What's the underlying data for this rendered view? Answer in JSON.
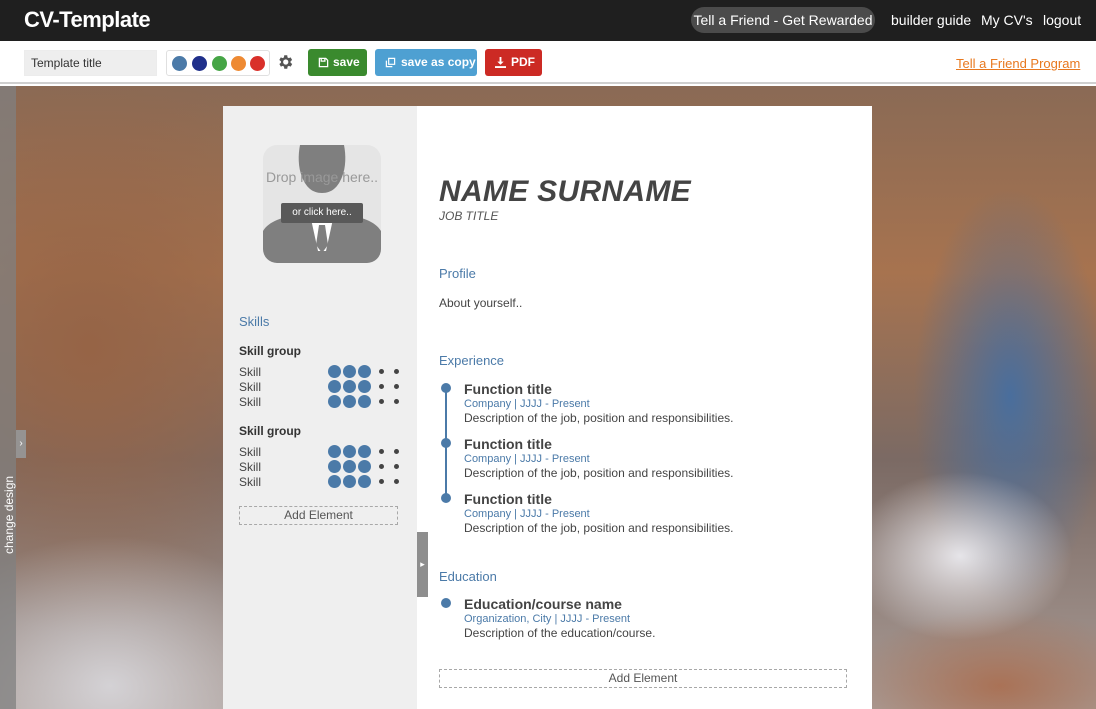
{
  "nav": {
    "logo": "CV-Template",
    "tell_friend": "Tell a Friend - Get Rewarded",
    "builder_guide": "builder guide",
    "my_cvs": "My CV's",
    "logout": "logout"
  },
  "toolbar": {
    "template_title": "Template title",
    "palette": [
      "#4b7aa8",
      "#1f2f8a",
      "#46a546",
      "#ee8a33",
      "#d9302a"
    ],
    "save_label": "save",
    "save_copy_label": "save as copy",
    "pdf_label": "PDF",
    "colors": {
      "save": "#3a8a2e",
      "save_copy": "#4ea0d2",
      "pdf": "#cc2a24"
    },
    "friend_program": "Tell a Friend Program"
  },
  "side": {
    "change_design": "change design",
    "photo_drop": "Drop image here..",
    "photo_click": "or click here..",
    "skills_title": "Skills",
    "skill_groups": [
      {
        "title": "Skill group",
        "skills": [
          {
            "label": "Skill",
            "level": 3,
            "max": 5
          },
          {
            "label": "Skill",
            "level": 3,
            "max": 5
          },
          {
            "label": "Skill",
            "level": 3,
            "max": 5
          }
        ]
      },
      {
        "title": "Skill group",
        "skills": [
          {
            "label": "Skill",
            "level": 3,
            "max": 5
          },
          {
            "label": "Skill",
            "level": 3,
            "max": 5
          },
          {
            "label": "Skill",
            "level": 3,
            "max": 5
          }
        ]
      }
    ],
    "add_element": "Add Element"
  },
  "main": {
    "name": "NAME  SURNAME",
    "job_title": "JOB TITLE",
    "profile_title": "Profile",
    "profile_text": "About yourself..",
    "experience_title": "Experience",
    "experience": [
      {
        "title": "Function title",
        "sub": "Company | JJJJ - Present",
        "desc": "Description of the job, position and responsibilities."
      },
      {
        "title": "Function title",
        "sub": "Company | JJJJ - Present",
        "desc": "Description of the job, position and responsibilities."
      },
      {
        "title": "Function title",
        "sub": "Company | JJJJ - Present",
        "desc": "Description of the job, position and responsibilities."
      }
    ],
    "education_title": "Education",
    "education": [
      {
        "title": "Education/course name",
        "sub": "Organization, City | JJJJ - Present",
        "desc": "Description of the education/course."
      }
    ],
    "add_element": "Add Element",
    "accent": "#4b7aa8"
  }
}
